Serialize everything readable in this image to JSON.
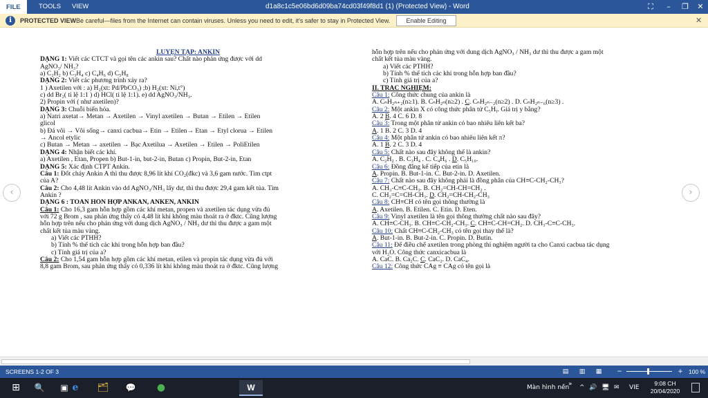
{
  "titlebar": {
    "menu": [
      "FILE",
      "TOOLS",
      "VIEW"
    ],
    "doc_title": "d1a8c1c5e06bd6d09ba74cd03f49f8d1 (1) (Protected View) - Word",
    "controls": [
      "⛶",
      "–",
      "❐",
      "✕"
    ]
  },
  "protected_view": {
    "title": "PROTECTED VIEW",
    "message": "Be careful—files from the Internet can contain viruses. Unless you need to edit, it's safer to stay in Protected View.",
    "button": "Enable Editing",
    "close": "✕"
  },
  "document": {
    "left": [
      {
        "c": "head",
        "t": "LUYỆN TẬP: ANKIN"
      },
      {
        "c": "",
        "t": "<b>DẠNG 1:</b>  Viết các CTCT và gọi tên  các ankin sau? Chất nào phản ứng được với dd"
      },
      {
        "c": "",
        "t": "AgNO₃/ NH₃?"
      },
      {
        "c": "",
        "t": "a) C₂H₂                b) C₃H₄                  c) C₄H₆                  d) C₅H₈"
      },
      {
        "c": "",
        "t": "<b>DẠNG 2:</b> Viết các phương trình xảy ra?"
      },
      {
        "c": "",
        "t": "1 ) Axetilen  với :  a) H₂(xt: Pd/PbCO₃)      ;b) H₂(xt: Ni,t°)"
      },
      {
        "c": "",
        "t": "                            c) dd Br₂( tỉ lệ 1:1 )       d) HCl( tỉ lệ 1:1).     e) dd AgNO₃/NH₃."
      },
      {
        "c": "",
        "t": "2) Propin với ( như axetilen)?"
      },
      {
        "c": "",
        "t": "<b>DẠNG 3:</b> Chuỗi biến hóa."
      },
      {
        "c": "",
        "t": "a) Natri axetat→   Metan →  Axetilen →  Vinyl axetilen → Butan →  Etilen →  Etilen"
      },
      {
        "c": "",
        "t": "glicol"
      },
      {
        "c": "",
        "t": "b) Đá vôi → Vôi sống→  canxi cacbua→ Etin → Etilen→  Etan →  Etyl clorua →   Etilen"
      },
      {
        "c": "",
        "t": "→ Ancol etylic"
      },
      {
        "c": "",
        "t": "c) Butan → Metan  → axetilen →  Bạc Axetilua → Axetilen  → Etilen  → PoliEtilen"
      },
      {
        "c": "",
        "t": "<b>DẠNG 4:</b> Nhận biết các khí."
      },
      {
        "c": "",
        "t": "a) Axetilen , Etan, Propen   b) But-1-in, but-2-in, Butan   c) Propin, But-2-in, Etan"
      },
      {
        "c": "",
        "t": "<b>DẠNG 5:</b> Xác định CTPT Ankin."
      },
      {
        "c": "",
        "t": "<b>Câu 1:</b> Đốt cháy Ankin A thì thu được 8,96 lít khí CO₂(đkc) và 3,6 gam nước.   Tìm ctpt"
      },
      {
        "c": "",
        "t": "của A?"
      },
      {
        "c": "",
        "t": "<b>Câu 2:</b> Cho 4,48 lít  Ankin  vào dd AgNO₃/NH₃ lấy dư, thì thu được 29,4 gam kết tủa. Tìm"
      },
      {
        "c": "",
        "t": "Ankin ?"
      },
      {
        "c": "",
        "t": "<b>DẠNG 6 : TOÁN HỖN HỢP ANKAN, ANKEN, ANKIN</b>"
      },
      {
        "c": "",
        "t": "<b><u>Câu 1:</u></b> Cho  16,3 gam  hỗn hợp gồm các khí metan, propen và axetilen tác dụng vừa đủ"
      },
      {
        "c": "",
        "t": "với 72 g Brom , sau phản ứng thấy có 4,48 lít khí không màu thoát ra ở đktc. Cũng lượng"
      },
      {
        "c": "",
        "t": "hỗn hợp trên nếu cho phản ứng với dung dịch AgNO₃ / NH₃ dư thì thu được a gam một"
      },
      {
        "c": "",
        "t": "chất kết tủa màu vàng."
      },
      {
        "c": "ind2",
        "t": "a)   Viết các PTHH?"
      },
      {
        "c": "ind2",
        "t": "b)   Tính % thể tích các khí trong hỗn hợp ban đầu?"
      },
      {
        "c": "ind2",
        "t": "c)   Tính giá trị của a?"
      },
      {
        "c": "",
        "t": "<b><u>Câu 2:</u></b> Cho  1,54 gam  hỗn hợp gồm các khí metan, etilen và propin tác dụng vừa đủ với"
      },
      {
        "c": "",
        "t": "8,8 gam Brom, sau phản ứng thấy có 0,336 lít khí không màu thoát ra ở đktc. Cũng lượng"
      }
    ],
    "right": [
      {
        "c": "",
        "t": "hỗn hợp trên nếu cho phản ứng với dung dịch AgNO₃ / NH₃ dư thì thu được a gam một"
      },
      {
        "c": "",
        "t": "chất kết tủa màu vàng."
      },
      {
        "c": "ind2",
        "t": "                                  a)  Viết các PTHH?"
      },
      {
        "c": "ind2",
        "t": "                                  b)  Tính % thể tích các khí trong hỗn hợp ban đầu?"
      },
      {
        "c": "ind2",
        "t": "                                  c)  Tính giá trị của a?"
      },
      {
        "c": "sec",
        "t": "II. TRẮC NGHIỆM:"
      },
      {
        "c": "",
        "t": "<span class=\"u\">Câu 1:</span> Công thức chung của ankin là"
      },
      {
        "c": "",
        "t": "A. CₙH₂ₙ₊₂(n≥1).       B. CₙH₂ₙ(n≥2) .     <u>C</u>. CₙH₂ₙ₋₂(n≥2) .   D. CₙH₂ₙ₋₆(n≥3) ."
      },
      {
        "c": "",
        "t": "<span class=\"u\">Câu 2:</span> Một ankin X có công thức phân tử C₅Hᵧ. Giá trị y bằng?"
      },
      {
        "c": "",
        "t": "A. 2                                 <u>B</u>. 4                                C. 6                                D. 8"
      },
      {
        "c": "",
        "t": "<span class=\"u\">Câu 3:</span> Trong một phân tử ankin có bao nhiêu liên kết ba?"
      },
      {
        "c": "",
        "t": "<u>A</u>. 1                                 B. 2                                C. 3                                D. 4"
      },
      {
        "c": "",
        "t": "<span class=\"u\">Câu 4:</span> Một phân tử ankin có bao nhiêu liên kết π?"
      },
      {
        "c": "",
        "t": "A. 1                                 <u>B</u>. 2                                C. 3                                D. 4"
      },
      {
        "c": "",
        "t": "<span class=\"u\">Câu 5:</span> Chất nào sau đây không thể là ankin?"
      },
      {
        "c": "",
        "t": "A. C₂H₂ .                          B. C₃H₄ .                     C. C₄H₆ .                        <u>D</u>. C₅H₁₀."
      },
      {
        "c": "",
        "t": "<span class=\"u\">Câu 6:</span> Đồng đẳng kế tiếp của etin là"
      },
      {
        "c": "",
        "t": "<u>A</u>. Propin.                       B. But-1-in.                  C. But-2-in.                   D. Axetilen."
      },
      {
        "c": "",
        "t": "<span class=\"u\">Câu 7:</span> Chất nào sau đây không phải là đồng phân của CH≡C-CH₂-CH₃?"
      },
      {
        "c": "",
        "t": "A. CH₃-C≡C-CH₃.          B. CH₂=CH-CH=CH₂ ."
      },
      {
        "c": "",
        "t": "C. CH₂=C=CH-CH₃.         <u>D</u>. CH₂=CH-CH₂-CH₃"
      },
      {
        "c": "",
        "t": "<span class=\"u\">Câu 8:</span> CH≡CH có tên gọi thông thường là"
      },
      {
        "c": "",
        "t": "<u>A</u>. Axetilen.                      B. Etilen.                     C. Etin.                                                     D. Eten."
      },
      {
        "c": "",
        "t": "<span class=\"u\">Câu 9:</span> Vinyl axetilen là tên gọi thông thường chất nào sau đây?"
      },
      {
        "c": "",
        "t": "A. CH≡C-CH₃.     B. CH≡C-CH₂-CH₃.  <u>C</u>. CH≡C-CH=CH₂.    D. CH₃-C≡C-CH₃."
      },
      {
        "c": "",
        "t": "<span class=\"u\">Câu 10:</span> Chất CH≡C-CH₂-CH₃ có tên gọi thay thế là?"
      },
      {
        "c": "",
        "t": "<u>A</u>. But-1-in.                    B. But-2-in.                C. Propin.                                          D. Butin."
      },
      {
        "c": "",
        "t": "<span class=\"u\">Câu 11:</span> Để điều chế axetilen trong phòng thí nghiệm người ta cho Canxi cacbua tác dụng"
      },
      {
        "c": "",
        "t": "với H₂O. Công thức canxicacbua là"
      },
      {
        "c": "",
        "t": "A. CaC.                               B. Ca₂C.                      <u>C</u>. CaC₂.                          D. CaC₄."
      },
      {
        "c": "",
        "t": "<span class=\"u\">Câu 12:</span> Công thức CAg ≡ CAg có tên gọi là"
      }
    ]
  },
  "nav": {
    "prev": "‹",
    "next": "›"
  },
  "statusbar": {
    "screens": "SCREENS 1-2 OF 3",
    "zoom": "100 %",
    "zoom_fraction": 0.47
  },
  "taskbar": {
    "start": "⊞",
    "search": "🔍",
    "taskview": "▣",
    "apps": [
      "e",
      "🗂",
      "💬",
      "●",
      "W"
    ],
    "desktop": "Màn hình nền",
    "tray": [
      "»",
      "^",
      "🔊",
      "🖥",
      "✉"
    ],
    "lang": "VIE",
    "time": "9:08 CH",
    "date": "20/04/2020"
  }
}
